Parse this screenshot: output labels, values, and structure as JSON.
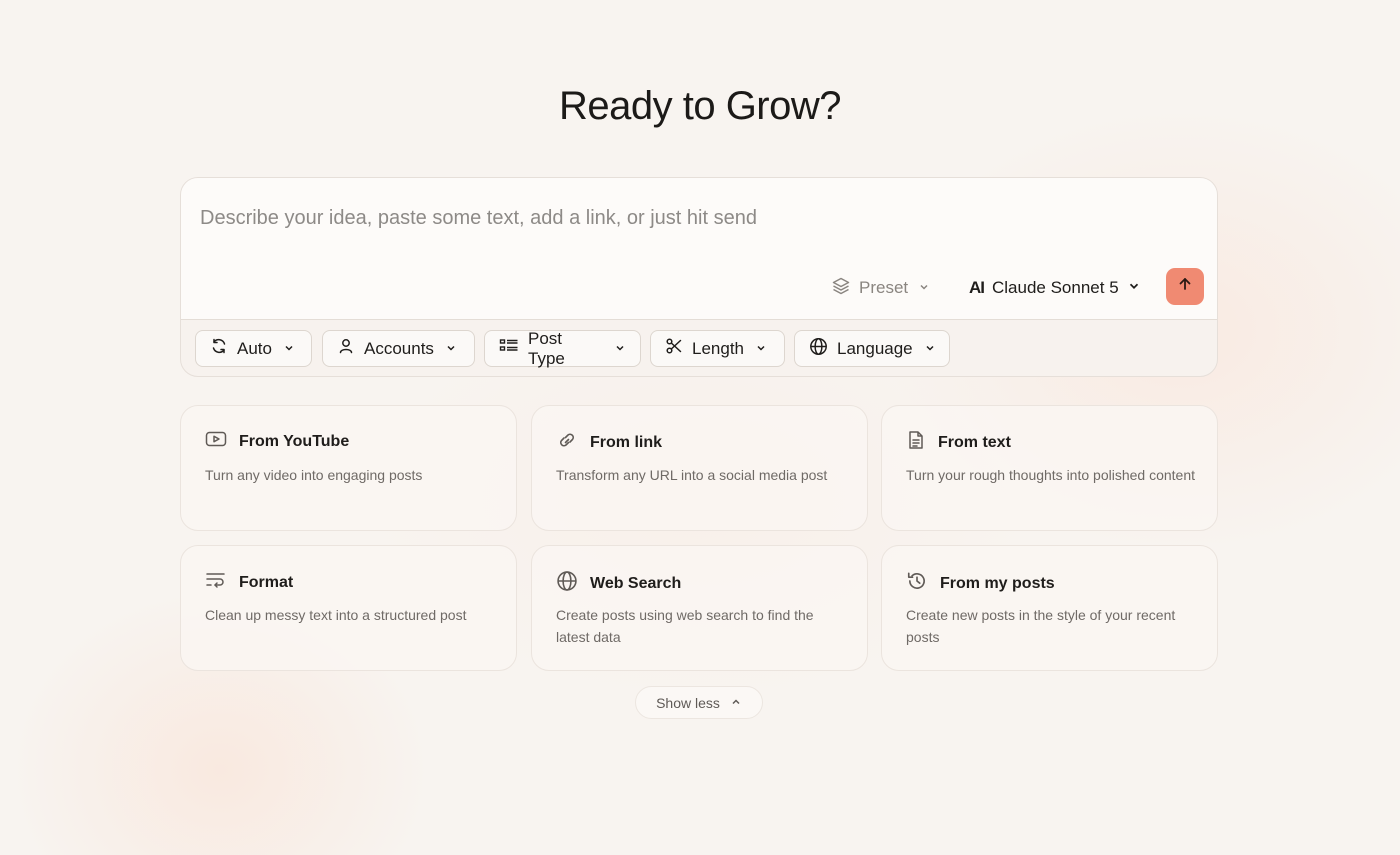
{
  "header": {
    "title": "Ready to Grow?"
  },
  "composer": {
    "placeholder": "Describe your idea, paste some text, add a link, or just hit send",
    "preset_label": "Preset",
    "model_brand": "AI",
    "model_label": "Claude Sonnet 5",
    "send_icon": "arrow-up-icon",
    "accent_color": "#f08a72"
  },
  "options": [
    {
      "label": "Auto",
      "icon": "refresh-icon"
    },
    {
      "label": "Accounts",
      "icon": "user-icon"
    },
    {
      "label": "Post Type",
      "icon": "list-icon"
    },
    {
      "label": "Length",
      "icon": "scissors-icon"
    },
    {
      "label": "Language",
      "icon": "globe-icon"
    }
  ],
  "cards": [
    {
      "title": "From YouTube",
      "description": "Turn any video into engaging posts",
      "icon": "youtube-icon"
    },
    {
      "title": "From link",
      "description": "Transform any URL into a social media post",
      "icon": "link-icon"
    },
    {
      "title": "From text",
      "description": "Turn your rough thoughts into polished content",
      "icon": "document-icon"
    },
    {
      "title": "Format",
      "description": "Clean up messy text into a structured post",
      "icon": "format-icon"
    },
    {
      "title": "Web Search",
      "description": "Create posts using web search to find the latest data",
      "icon": "globe-icon"
    },
    {
      "title": "From my posts",
      "description": "Create new posts in the style of your recent posts",
      "icon": "history-icon"
    }
  ],
  "footer": {
    "show_less_label": "Show less"
  }
}
